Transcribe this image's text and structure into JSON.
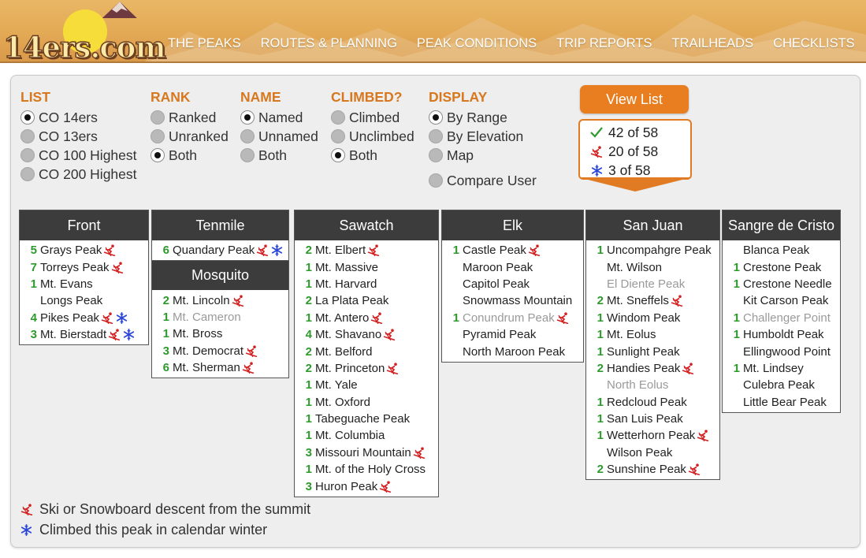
{
  "header": {
    "logo_text": "14ers.com",
    "nav": [
      "THE PEAKS",
      "ROUTES & PLANNING",
      "PEAK CONDITIONS",
      "TRIP REPORTS",
      "TRAILHEADS",
      "CHECKLISTS"
    ]
  },
  "options": {
    "list": {
      "title": "LIST",
      "items": [
        "CO 14ers",
        "CO 13ers",
        "CO 100 Highest",
        "CO 200 Highest"
      ],
      "selected": 0
    },
    "rank": {
      "title": "RANK",
      "items": [
        "Ranked",
        "Unranked",
        "Both"
      ],
      "selected": 2
    },
    "name": {
      "title": "NAME",
      "items": [
        "Named",
        "Unnamed",
        "Both"
      ],
      "selected": 0
    },
    "climbed": {
      "title": "CLIMBED?",
      "items": [
        "Climbed",
        "Unclimbed",
        "Both"
      ],
      "selected": 2
    },
    "display": {
      "title": "DISPLAY",
      "items": [
        "By Range",
        "By Elevation",
        "Map"
      ],
      "selected": 0,
      "compare": "Compare User"
    }
  },
  "view_list_label": "View List",
  "stats": {
    "climbed": "42 of 58",
    "skied": "20 of 58",
    "winter": "3 of 58"
  },
  "colors": {
    "accent": "#e97e21",
    "title": "#d8781e",
    "count": "#2e9a2e",
    "ski": "#d42020",
    "flake": "#2a45d8",
    "header_bg": "#3c3c3c"
  },
  "ranges": {
    "front": {
      "name": "Front",
      "peaks": [
        {
          "count": "5",
          "name": "Grays Peak",
          "ski": true
        },
        {
          "count": "7",
          "name": "Torreys Peak",
          "ski": true
        },
        {
          "count": "1",
          "name": "Mt. Evans"
        },
        {
          "count": "",
          "name": "Longs Peak"
        },
        {
          "count": "4",
          "name": "Pikes Peak",
          "ski": true,
          "winter": true
        },
        {
          "count": "3",
          "name": "Mt. Bierstadt",
          "ski": true,
          "winter": true
        }
      ]
    },
    "tenmile": {
      "name": "Tenmile",
      "peaks": [
        {
          "count": "6",
          "name": "Quandary Peak",
          "ski": true,
          "winter": true
        }
      ]
    },
    "mosquito": {
      "name": "Mosquito",
      "peaks": [
        {
          "count": "2",
          "name": "Mt. Lincoln",
          "ski": true
        },
        {
          "count": "1",
          "name": "Mt. Cameron",
          "dim": true
        },
        {
          "count": "1",
          "name": "Mt. Bross"
        },
        {
          "count": "3",
          "name": "Mt. Democrat",
          "ski": true
        },
        {
          "count": "6",
          "name": "Mt. Sherman",
          "ski": true
        }
      ]
    },
    "sawatch": {
      "name": "Sawatch",
      "peaks": [
        {
          "count": "2",
          "name": "Mt. Elbert",
          "ski": true
        },
        {
          "count": "1",
          "name": "Mt. Massive"
        },
        {
          "count": "1",
          "name": "Mt. Harvard"
        },
        {
          "count": "2",
          "name": "La Plata Peak"
        },
        {
          "count": "1",
          "name": "Mt. Antero",
          "ski": true
        },
        {
          "count": "4",
          "name": "Mt. Shavano",
          "ski": true
        },
        {
          "count": "2",
          "name": "Mt. Belford"
        },
        {
          "count": "2",
          "name": "Mt. Princeton",
          "ski": true
        },
        {
          "count": "1",
          "name": "Mt. Yale"
        },
        {
          "count": "1",
          "name": "Mt. Oxford"
        },
        {
          "count": "1",
          "name": "Tabeguache Peak"
        },
        {
          "count": "1",
          "name": "Mt. Columbia"
        },
        {
          "count": "3",
          "name": "Missouri Mountain",
          "ski": true
        },
        {
          "count": "1",
          "name": "Mt. of the Holy Cross"
        },
        {
          "count": "3",
          "name": "Huron Peak",
          "ski": true
        }
      ]
    },
    "elk": {
      "name": "Elk",
      "peaks": [
        {
          "count": "1",
          "name": "Castle Peak",
          "ski": true
        },
        {
          "count": "",
          "name": "Maroon Peak"
        },
        {
          "count": "",
          "name": "Capitol Peak"
        },
        {
          "count": "",
          "name": "Snowmass Mountain"
        },
        {
          "count": "1",
          "name": "Conundrum Peak",
          "dim": true,
          "ski": true
        },
        {
          "count": "",
          "name": "Pyramid Peak"
        },
        {
          "count": "",
          "name": "North Maroon Peak"
        }
      ]
    },
    "sanjuan": {
      "name": "San Juan",
      "peaks": [
        {
          "count": "1",
          "name": "Uncompahgre Peak"
        },
        {
          "count": "",
          "name": "Mt. Wilson"
        },
        {
          "count": "",
          "name": "El Diente Peak",
          "dim": true
        },
        {
          "count": "2",
          "name": "Mt. Sneffels",
          "ski": true
        },
        {
          "count": "1",
          "name": "Windom Peak"
        },
        {
          "count": "1",
          "name": "Mt. Eolus"
        },
        {
          "count": "1",
          "name": "Sunlight Peak"
        },
        {
          "count": "2",
          "name": "Handies Peak",
          "ski": true
        },
        {
          "count": "",
          "name": "North Eolus",
          "dim": true
        },
        {
          "count": "1",
          "name": "Redcloud Peak"
        },
        {
          "count": "1",
          "name": "San Luis Peak"
        },
        {
          "count": "1",
          "name": "Wetterhorn Peak",
          "ski": true
        },
        {
          "count": "",
          "name": "Wilson Peak"
        },
        {
          "count": "2",
          "name": "Sunshine Peak",
          "ski": true
        }
      ]
    },
    "sangre": {
      "name": "Sangre de Cristo",
      "peaks": [
        {
          "count": "",
          "name": "Blanca Peak"
        },
        {
          "count": "1",
          "name": "Crestone Peak"
        },
        {
          "count": "1",
          "name": "Crestone Needle"
        },
        {
          "count": "",
          "name": "Kit Carson Peak"
        },
        {
          "count": "1",
          "name": "Challenger Point",
          "dim": true
        },
        {
          "count": "1",
          "name": "Humboldt Peak"
        },
        {
          "count": "",
          "name": "Ellingwood Point"
        },
        {
          "count": "1",
          "name": "Mt. Lindsey"
        },
        {
          "count": "",
          "name": "Culebra Peak"
        },
        {
          "count": "",
          "name": "Little Bear Peak"
        }
      ]
    }
  },
  "legend": {
    "ski": "Ski or Snowboard descent from the summit",
    "winter": "Climbed this peak in calendar winter"
  }
}
